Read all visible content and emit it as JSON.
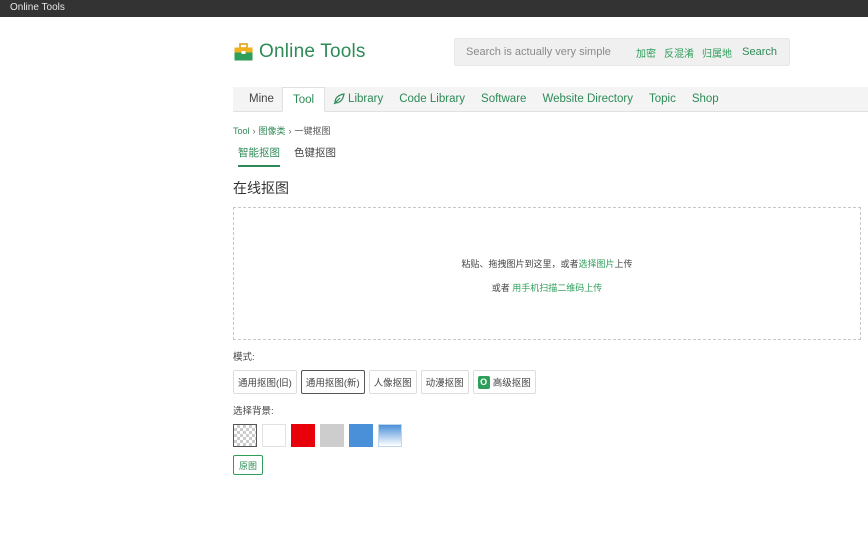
{
  "window": {
    "title": "Online Tools"
  },
  "header": {
    "logo_text": "Online Tools",
    "logo_icon": "toolbox-icon",
    "search": {
      "placeholder": "Search is actually very simple",
      "quick_links": [
        "加密",
        "反混淆",
        "归属地"
      ],
      "button_label": "Search"
    }
  },
  "nav": {
    "items": [
      {
        "label": "Mine"
      },
      {
        "label": "Tool",
        "active": true
      },
      {
        "label": "Library",
        "icon": "leaf-icon"
      },
      {
        "label": "Code Library"
      },
      {
        "label": "Software"
      },
      {
        "label": "Website Directory"
      },
      {
        "label": "Topic"
      },
      {
        "label": "Shop"
      }
    ]
  },
  "breadcrumb": {
    "items": [
      "Tool",
      "图像类",
      "一键抠图"
    ],
    "separator": "›"
  },
  "subtabs": [
    {
      "label": "智能抠图",
      "active": true
    },
    {
      "label": "色键抠图"
    }
  ],
  "page_title": "在线抠图",
  "dropzone": {
    "line1_prefix": "粘贴、拖拽图片到这里，或者",
    "line1_link": "选择图片",
    "line1_suffix": "上传",
    "line2_prefix": "或者",
    "line2_link": "用手机扫描二维码上传"
  },
  "mode": {
    "label": "模式:",
    "options": [
      {
        "label": "通用抠图(旧)"
      },
      {
        "label": "通用抠图(新)",
        "selected": true
      },
      {
        "label": "人像抠图"
      },
      {
        "label": "动漫抠图"
      },
      {
        "label": "高级抠图",
        "badge": "O"
      }
    ]
  },
  "background": {
    "label": "选择背景:",
    "swatches": [
      "transparent",
      "#ffffff",
      "#e8000b",
      "#cdcdcd",
      "#4a90d9",
      "gradient-blue-white"
    ]
  },
  "original_button": "原图",
  "colors": {
    "accent": "#2e8b57",
    "link": "#2e9e5b"
  }
}
